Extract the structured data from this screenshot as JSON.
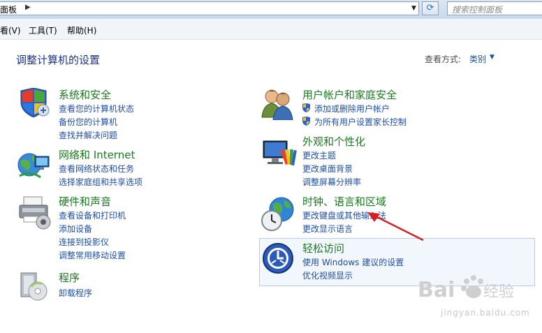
{
  "address_bar": {
    "path": "面板",
    "search_placeholder": "搜索控制面板"
  },
  "menu": [
    {
      "label": "看(V)"
    },
    {
      "label": "工具(T)"
    },
    {
      "label": "帮助(H)"
    }
  ],
  "header": {
    "title": "调整计算机的设置",
    "view_by_label": "查看方式:",
    "view_by_value": "类别"
  },
  "categories": [
    {
      "title": "系统和安全",
      "icon": "shield-icon",
      "links": [
        "查看您的计算机状态",
        "备份您的计算机",
        "查找并解决问题"
      ]
    },
    {
      "title": "网络和 Internet",
      "icon": "network-globe-icon",
      "links": [
        "查看网络状态和任务",
        "选择家庭组和共享选项"
      ]
    },
    {
      "title": "硬件和声音",
      "icon": "printer-icon",
      "links": [
        "查看设备和打印机",
        "添加设备",
        "连接到投影仪",
        "调整常用移动设置"
      ]
    },
    {
      "title": "程序",
      "icon": "programs-icon",
      "links": [
        "卸载程序"
      ]
    },
    {
      "title": "用户帐户和家庭安全",
      "icon": "users-icon",
      "links": [
        "添加或删除用户帐户",
        "为所有用户设置家长控制"
      ]
    },
    {
      "title": "外观和个性化",
      "icon": "appearance-icon",
      "links": [
        "更改主题",
        "更改桌面背景",
        "调整屏幕分辨率"
      ]
    },
    {
      "title": "时钟、语言和区域",
      "icon": "clock-globe-icon",
      "links": [
        "更改键盘或其他输入法",
        "更改显示语言"
      ]
    },
    {
      "title": "轻松访问",
      "icon": "ease-of-access-icon",
      "links": [
        "使用 Windows 建议的设置",
        "优化视频显示"
      ]
    }
  ],
  "watermark": {
    "brand": "Bai du 经验",
    "sub": "jingyan.baidu.com"
  },
  "colors": {
    "category_title": "#1b7a20",
    "link": "#1e4ea7",
    "page_title": "#1e3287",
    "annotation_arrow": "#d42020"
  }
}
